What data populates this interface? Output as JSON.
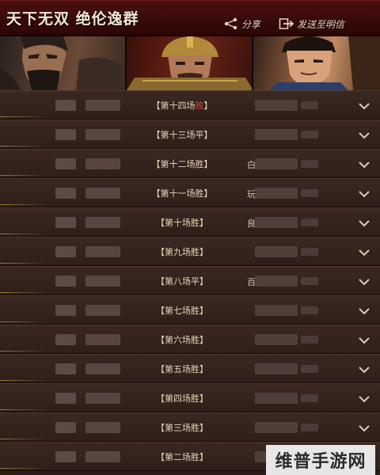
{
  "header": {
    "title": "天下无双  绝伦逸群",
    "share_label": "分享",
    "send_label": "发送至明信"
  },
  "portraits": [
    {
      "name": "portrait-1"
    },
    {
      "name": "portrait-2"
    },
    {
      "name": "portrait-3"
    }
  ],
  "records": [
    {
      "label": "【第十四场",
      "result": "败",
      "result_type": "lose",
      "tail": "】",
      "initial": ""
    },
    {
      "label": "【第十三场",
      "result": "平",
      "result_type": "draw",
      "tail": "】",
      "initial": ""
    },
    {
      "label": "【第十二场",
      "result": "胜",
      "result_type": "win",
      "tail": "】",
      "initial": "白"
    },
    {
      "label": "【第十一场",
      "result": "胜",
      "result_type": "win",
      "tail": "】",
      "initial": "玩"
    },
    {
      "label": "【第十场",
      "result": "胜",
      "result_type": "win",
      "tail": "】",
      "initial": "良"
    },
    {
      "label": "【第九场",
      "result": "胜",
      "result_type": "win",
      "tail": "】",
      "initial": ""
    },
    {
      "label": "【第八场",
      "result": "平",
      "result_type": "draw",
      "tail": "】",
      "initial": "百"
    },
    {
      "label": "【第七场",
      "result": "胜",
      "result_type": "win",
      "tail": "】",
      "initial": ""
    },
    {
      "label": "【第六场",
      "result": "胜",
      "result_type": "win",
      "tail": "】",
      "initial": ""
    },
    {
      "label": "【第五场",
      "result": "胜",
      "result_type": "win",
      "tail": "】",
      "initial": ""
    },
    {
      "label": "【第四场",
      "result": "胜",
      "result_type": "win",
      "tail": "】",
      "initial": ""
    },
    {
      "label": "【第三场",
      "result": "胜",
      "result_type": "win",
      "tail": "】",
      "initial": ""
    },
    {
      "label": "【第二场",
      "result": "胜",
      "result_type": "win",
      "tail": "】",
      "initial": ""
    }
  ],
  "watermark": {
    "text": "维普手游网"
  },
  "colors": {
    "lose": "#d24a3c",
    "text": "#e6d6b8",
    "header": "#3a0b0b"
  }
}
